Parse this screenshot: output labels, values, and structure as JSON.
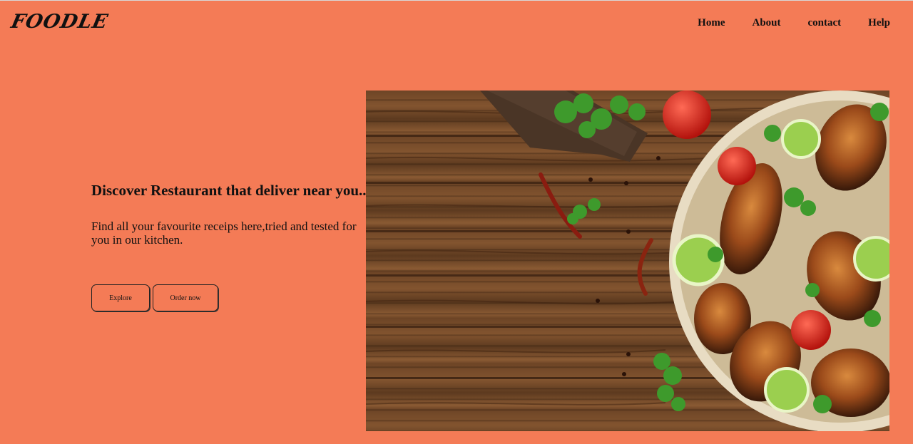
{
  "header": {
    "logo": "FOODLE",
    "nav": [
      "Home",
      "About",
      "contact",
      "Help"
    ]
  },
  "hero": {
    "title": "Discover Restaurant that deliver near you..",
    "subtitle": "Find all your favourite receips here,tried and tested for you in our kitchen.",
    "explore_label": "Explore",
    "order_label": "Order now"
  },
  "image": {
    "icon": "grilled-chicken-wings-photo"
  },
  "colors": {
    "background": "#f47b56",
    "text": "#111111"
  }
}
